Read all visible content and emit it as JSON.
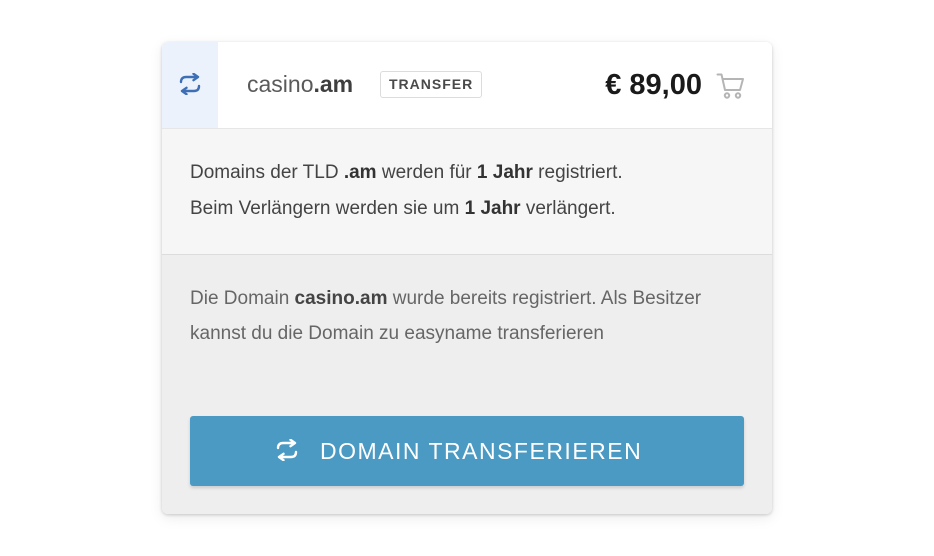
{
  "header": {
    "icon": "transfer-arrows-icon",
    "domain_name": "casino",
    "domain_tld": ".am",
    "badge": "TRANSFER",
    "price": "€ 89,00",
    "cart_icon": "cart-icon"
  },
  "info": {
    "line1_pre": "Domains der TLD ",
    "line1_tld": ".am",
    "line1_mid": " werden für ",
    "line1_term": "1 Jahr",
    "line1_post": " registriert.",
    "line2_pre": "Beim Verlängern werden sie um ",
    "line2_term": "1 Jahr",
    "line2_post": " verlängert."
  },
  "transfer": {
    "text_pre": "Die Domain ",
    "text_domain": "casino.am",
    "text_post": " wurde bereits registriert. Als Besitzer kannst du die Domain zu easyname transferieren",
    "button_label": "DOMAIN TRANSFERIEREN",
    "button_icon": "transfer-arrows-icon"
  },
  "colors": {
    "accent": "#4a9ac3",
    "icon_blue": "#3d6fb6",
    "icon_bg": "#ecf2fb"
  }
}
